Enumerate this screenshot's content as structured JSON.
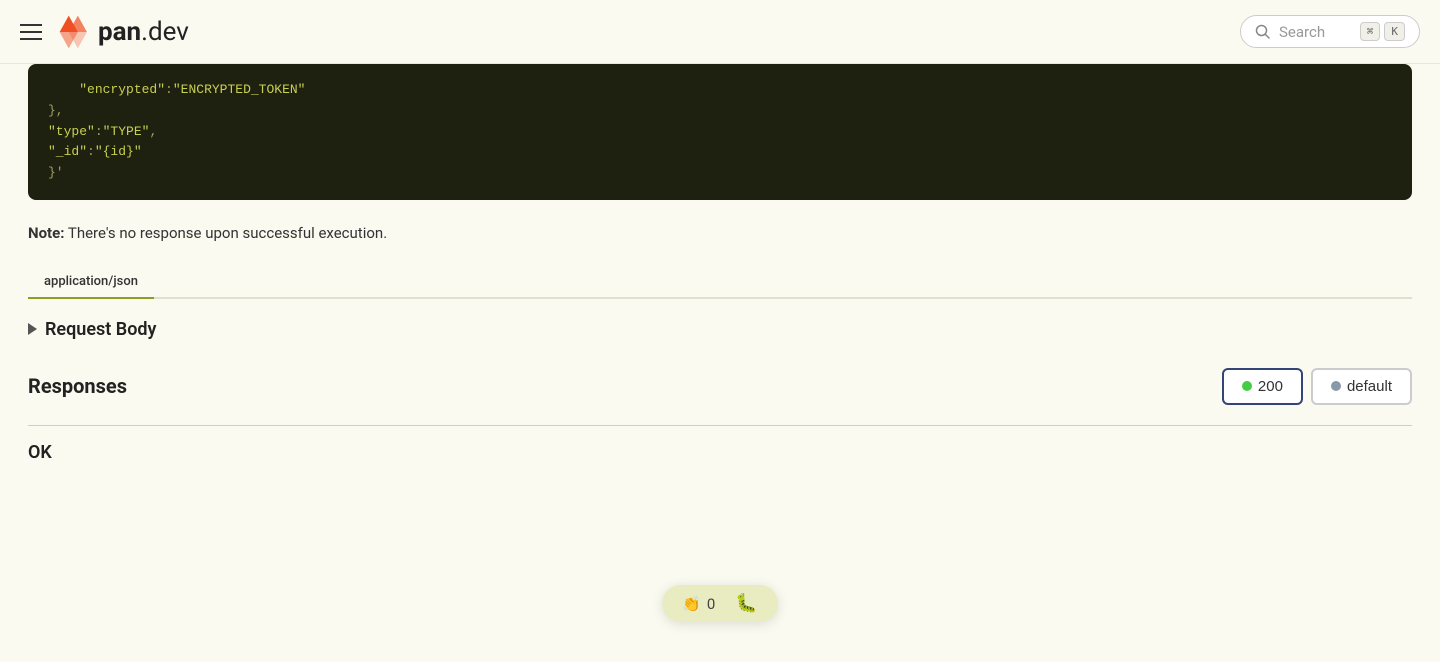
{
  "header": {
    "logo_brand": "pan",
    "logo_domain": ".dev",
    "search_placeholder": "Search",
    "kbd_modifier": "⌘",
    "kbd_key": "K"
  },
  "code_block": {
    "lines": [
      "    \"encrypted\":\"ENCRYPTED_TOKEN\"",
      "},",
      "\"type\":\"TYPE\",",
      "\"_id\":\"{id}\"",
      "}'"
    ]
  },
  "note": {
    "label": "Note:",
    "text": " There's no response upon successful execution."
  },
  "tabs": [
    {
      "label": "application/json",
      "active": true
    }
  ],
  "request_body": {
    "label": "Request Body"
  },
  "responses": {
    "label": "Responses",
    "buttons": [
      {
        "id": "200",
        "label": "200",
        "dot_color": "green",
        "active": true
      },
      {
        "id": "default",
        "label": "default",
        "dot_color": "gray",
        "active": false
      }
    ]
  },
  "floating_bar": {
    "clap_count": "0",
    "clap_icon": "👏",
    "bug_icon": "🐛"
  },
  "ok_label": "OK"
}
